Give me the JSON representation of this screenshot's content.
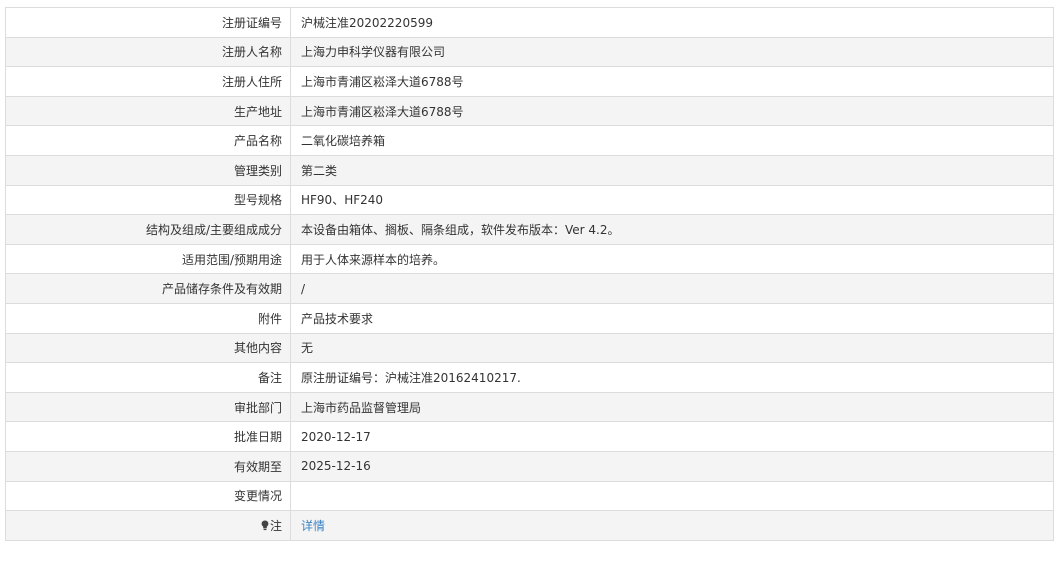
{
  "rows": [
    {
      "label": "注册证编号",
      "value": "沪械注准20202220599"
    },
    {
      "label": "注册人名称",
      "value": "上海力申科学仪器有限公司"
    },
    {
      "label": "注册人住所",
      "value": "上海市青浦区崧泽大道6788号"
    },
    {
      "label": "生产地址",
      "value": "上海市青浦区崧泽大道6788号"
    },
    {
      "label": "产品名称",
      "value": "二氧化碳培养箱"
    },
    {
      "label": "管理类别",
      "value": "第二类"
    },
    {
      "label": "型号规格",
      "value": "HF90、HF240"
    },
    {
      "label": "结构及组成/主要组成成分",
      "value": "本设备由箱体、搁板、隔条组成，软件发布版本：Ver 4.2。"
    },
    {
      "label": "适用范围/预期用途",
      "value": "用于人体来源样本的培养。"
    },
    {
      "label": "产品储存条件及有效期",
      "value": "/"
    },
    {
      "label": "附件",
      "value": "产品技术要求"
    },
    {
      "label": "其他内容",
      "value": "无"
    },
    {
      "label": "备注",
      "value": "原注册证编号：沪械注准20162410217."
    },
    {
      "label": "审批部门",
      "value": "上海市药品监督管理局"
    },
    {
      "label": "批准日期",
      "value": "2020-12-17"
    },
    {
      "label": "有效期至",
      "value": "2025-12-16"
    },
    {
      "label": "变更情况",
      "value": ""
    }
  ],
  "note_row": {
    "icon": "bulb-icon",
    "label": "注",
    "link_text": "详情"
  },
  "colors": {
    "link": "#3b83c6",
    "border": "#dcdcdc",
    "stripe": "#f4f4f4",
    "text": "#333333"
  }
}
